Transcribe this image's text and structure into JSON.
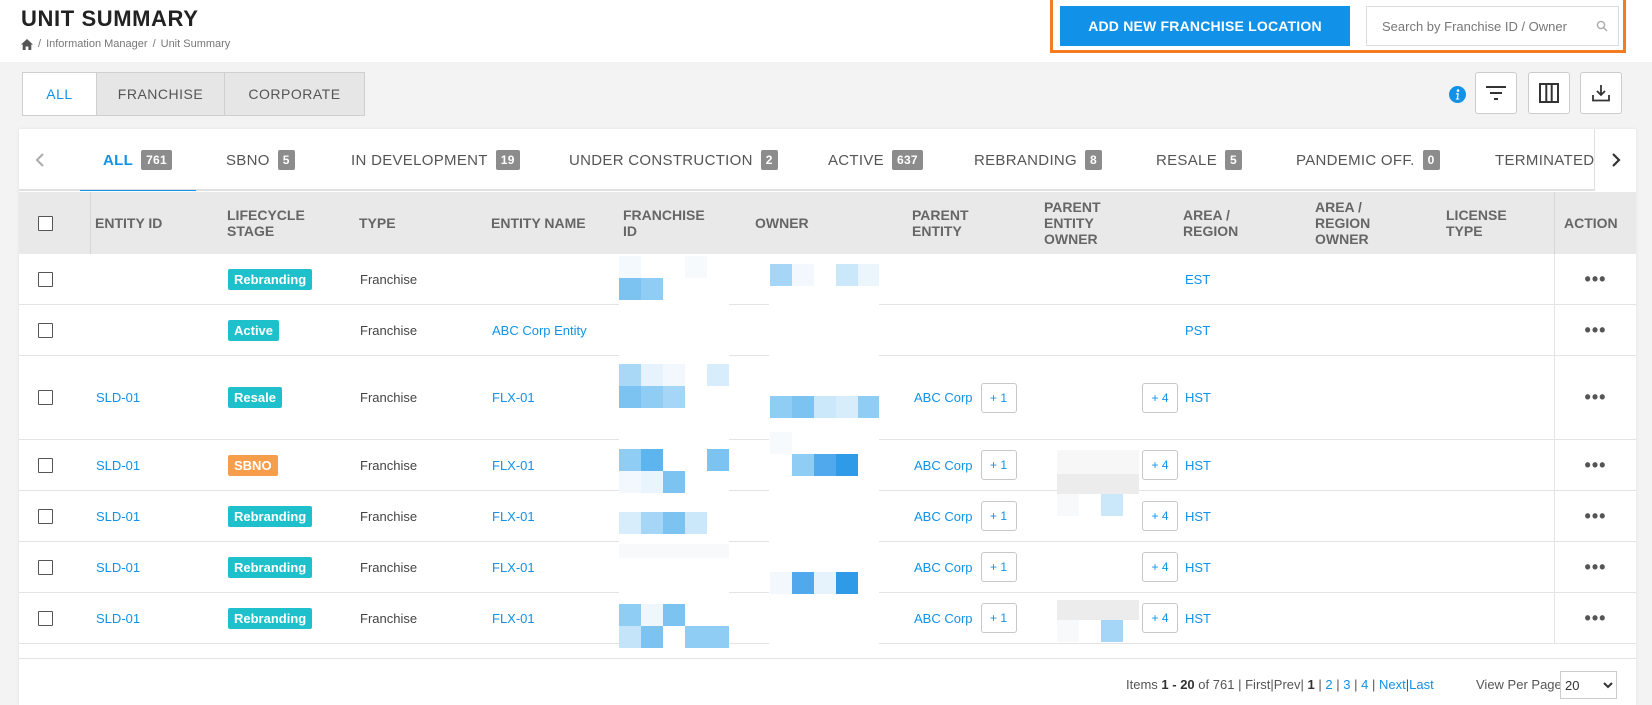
{
  "header": {
    "title": "UNIT SUMMARY",
    "breadcrumb": [
      "Information Manager",
      "Unit Summary"
    ],
    "add_button": "ADD NEW FRANCHISE LOCATION",
    "search_placeholder": "Search by Franchise ID / Owner"
  },
  "filter": {
    "segments": [
      "ALL",
      "FRANCHISE",
      "CORPORATE"
    ],
    "active_segment": "ALL"
  },
  "tabs": [
    {
      "label": "ALL",
      "count": "761"
    },
    {
      "label": "SBNO",
      "count": "5"
    },
    {
      "label": "IN DEVELOPMENT",
      "count": "19"
    },
    {
      "label": "UNDER CONSTRUCTION",
      "count": "2"
    },
    {
      "label": "ACTIVE",
      "count": "637"
    },
    {
      "label": "REBRANDING",
      "count": "8"
    },
    {
      "label": "RESALE",
      "count": "5"
    },
    {
      "label": "PANDEMIC OFF.",
      "count": "0"
    },
    {
      "label": "TERMINATED",
      "count": ""
    }
  ],
  "columns": {
    "entity_id": "ENTITY ID",
    "lifecycle_stage": "LIFECYCLE STAGE",
    "type": "TYPE",
    "entity_name": "ENTITY NAME",
    "franchise_id": "FRANCHISE ID",
    "owner": "OWNER",
    "parent_entity": "PARENT ENTITY",
    "parent_entity_owner": "PARENT ENTITY OWNER",
    "area_region": "AREA / REGION",
    "area_region_owner": "AREA / REGION OWNER",
    "license_type": "LICENSE TYPE",
    "action": "ACTION"
  },
  "rows": [
    {
      "entity_id": "",
      "stage": "Rebranding",
      "stage_color": "#1ec0cc",
      "type": "Franchise",
      "entity_name": "",
      "parent_entity": "",
      "parent_plus": "",
      "parent_owner_plus": "",
      "region": "EST"
    },
    {
      "entity_id": "",
      "stage": "Active",
      "stage_color": "#1ec0cc",
      "type": "Franchise",
      "entity_name": "ABC Corp Entity",
      "parent_entity": "",
      "parent_plus": "",
      "parent_owner_plus": "",
      "region": "PST"
    },
    {
      "entity_id": "SLD-01",
      "stage": "Resale",
      "stage_color": "#1ec0cc",
      "type": "Franchise",
      "entity_name": "FLX-01",
      "parent_entity": "ABC Corp",
      "parent_plus": "+ 1",
      "parent_owner_plus": "+ 4",
      "region": "HST"
    },
    {
      "entity_id": "SLD-01",
      "stage": "SBNO",
      "stage_color": "#f79e4c",
      "type": "Franchise",
      "entity_name": "FLX-01",
      "parent_entity": "ABC Corp",
      "parent_plus": "+ 1",
      "parent_owner_plus": "+ 4",
      "region": "HST"
    },
    {
      "entity_id": "SLD-01",
      "stage": "Rebranding",
      "stage_color": "#1ec0cc",
      "type": "Franchise",
      "entity_name": "FLX-01",
      "parent_entity": "ABC Corp",
      "parent_plus": "+ 1",
      "parent_owner_plus": "+ 4",
      "region": "HST"
    },
    {
      "entity_id": "SLD-01",
      "stage": "Rebranding",
      "stage_color": "#1ec0cc",
      "type": "Franchise",
      "entity_name": "FLX-01",
      "parent_entity": "ABC Corp",
      "parent_plus": "+ 1",
      "parent_owner_plus": "+ 4",
      "region": "HST"
    },
    {
      "entity_id": "SLD-01",
      "stage": "Rebranding",
      "stage_color": "#1ec0cc",
      "type": "Franchise",
      "entity_name": "FLX-01",
      "parent_entity": "ABC Corp",
      "parent_plus": "+ 1",
      "parent_owner_plus": "+ 4",
      "region": "HST"
    }
  ],
  "row_action_icon": "more-horizontal-icon",
  "pagination": {
    "items_label": "Items",
    "range": "1 - 20",
    "of_label": "of",
    "total": "761",
    "first": "First",
    "prev": "Prev",
    "current": "1",
    "pages": [
      "2",
      "3",
      "4"
    ],
    "next": "Next",
    "last": "Last",
    "view_per_page_label": "View Per Page",
    "per_page": "20"
  },
  "colors": {
    "accent": "#1192e8",
    "highlight_frame": "#f47b20",
    "badge_teal": "#1ec0cc",
    "badge_orange": "#f79e4c"
  }
}
